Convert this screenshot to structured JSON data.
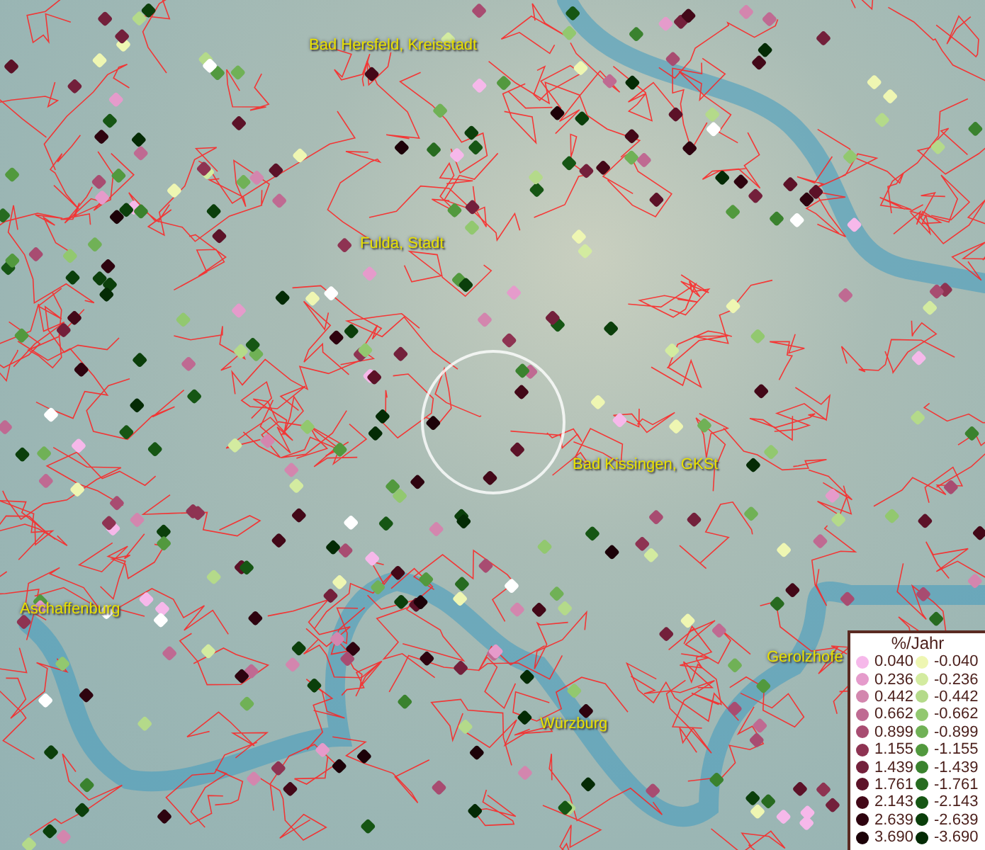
{
  "map": {
    "places": [
      {
        "name": "Bad Hersfeld, Kreisstadt"
      },
      {
        "name": "Fulda, Stadt"
      },
      {
        "name": "Bad Kissingen, GKSt"
      },
      {
        "name": "Aschaffenburg"
      },
      {
        "name": "Würzburg"
      },
      {
        "name": "Gerolzhofe"
      }
    ]
  },
  "legend": {
    "title": "%/Jahr",
    "positive": [
      {
        "value": "0.040",
        "color": "#f6b8ea"
      },
      {
        "value": "0.236",
        "color": "#e59bcb"
      },
      {
        "value": "0.442",
        "color": "#d386ae"
      },
      {
        "value": "0.662",
        "color": "#bf6a92"
      },
      {
        "value": "0.899",
        "color": "#a84c71"
      },
      {
        "value": "1.155",
        "color": "#8e3352"
      },
      {
        "value": "1.439",
        "color": "#73203b"
      },
      {
        "value": "1.761",
        "color": "#5c1228"
      },
      {
        "value": "2.143",
        "color": "#430818"
      },
      {
        "value": "2.639",
        "color": "#2e030f"
      },
      {
        "value": "3.690",
        "color": "#1c0108"
      }
    ],
    "negative": [
      {
        "value": "-0.040",
        "color": "#eef6b2"
      },
      {
        "value": "-0.236",
        "color": "#d3eba0"
      },
      {
        "value": "-0.442",
        "color": "#b4da8a"
      },
      {
        "value": "-0.662",
        "color": "#92c86f"
      },
      {
        "value": "-0.899",
        "color": "#70b156"
      },
      {
        "value": "-1.155",
        "color": "#52993e"
      },
      {
        "value": "-1.439",
        "color": "#3a822e"
      },
      {
        "value": "-1.761",
        "color": "#276b20"
      },
      {
        "value": "-2.143",
        "color": "#165614"
      },
      {
        "value": "-2.639",
        "color": "#0b3f0b"
      },
      {
        "value": "-3.690",
        "color": "#042b05"
      }
    ]
  }
}
